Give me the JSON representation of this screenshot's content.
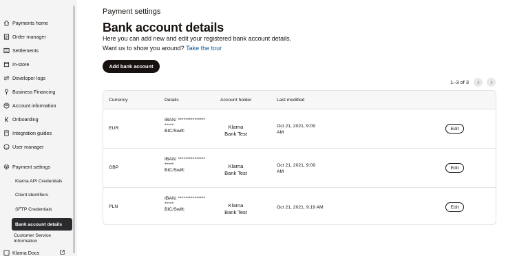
{
  "sidebar": {
    "items": [
      {
        "label": "Payments home",
        "icon": "home-icon"
      },
      {
        "label": "Order manager",
        "icon": "order-icon"
      },
      {
        "label": "Settlements",
        "icon": "settlements-icon"
      },
      {
        "label": "In-store",
        "icon": "store-icon"
      },
      {
        "label": "Developer logs",
        "icon": "arrows-icon"
      },
      {
        "label": "Business Financing",
        "icon": "financing-icon"
      },
      {
        "label": "Account information",
        "icon": "account-icon"
      },
      {
        "label": "Onboarding",
        "icon": "klarna-k-icon"
      },
      {
        "label": "Integration guides",
        "icon": "guide-icon"
      },
      {
        "label": "User manager",
        "icon": "user-icon"
      }
    ],
    "settings": {
      "label": "Payment settings",
      "icon": "gear-icon"
    },
    "sub_items": [
      {
        "label": "Klarna API Credentials"
      },
      {
        "label": "Client identifiers"
      },
      {
        "label": "SFTP Credentials"
      },
      {
        "label": "Bank account details"
      },
      {
        "label": "Customer Service Information"
      }
    ],
    "docs": {
      "label": "Klarna Docs",
      "icon": "external-link-icon"
    }
  },
  "main": {
    "page_title": "Payment settings",
    "heading": "Bank account details",
    "description": "Here you can add new and edit your registered bank account details.",
    "tour_prompt": "Want us to show you around?",
    "tour_link": "Take the tour",
    "add_button": "Add bank account",
    "pager": "1–3 of 3"
  },
  "table": {
    "headers": {
      "currency": "Currency",
      "details": "Details",
      "holder": "Account holder",
      "modified": "Last modified"
    },
    "rows": [
      {
        "currency": "EUR",
        "iban": "IBAN: ***************",
        "iban2": "*****",
        "bic": "BIC/Swift:",
        "holder1": "Klarna",
        "holder2": "Bank Test",
        "mod1": "Oct 21, 2021, 9:09",
        "mod2": "AM",
        "edit": "Edit"
      },
      {
        "currency": "GBP",
        "iban": "IBAN: ***************",
        "iban2": "*****",
        "bic": "BIC/Swift:",
        "holder1": "Klarna",
        "holder2": "Bank Test",
        "mod1": "Oct 21, 2021, 9:09",
        "mod2": "AM",
        "edit": "Edit"
      },
      {
        "currency": "PLN",
        "iban": "IBAN: ***************",
        "iban2": "*****",
        "bic": "BIC/Swift:",
        "holder1": "Klarna",
        "holder2": "Bank Test",
        "mod1": "Oct 21, 2021, 9:19 AM",
        "mod2": "",
        "edit": "Edit"
      }
    ]
  },
  "colors": {
    "accent": "#0b5a99",
    "dark": "#17120f",
    "active_bg": "#2b2b2e"
  }
}
